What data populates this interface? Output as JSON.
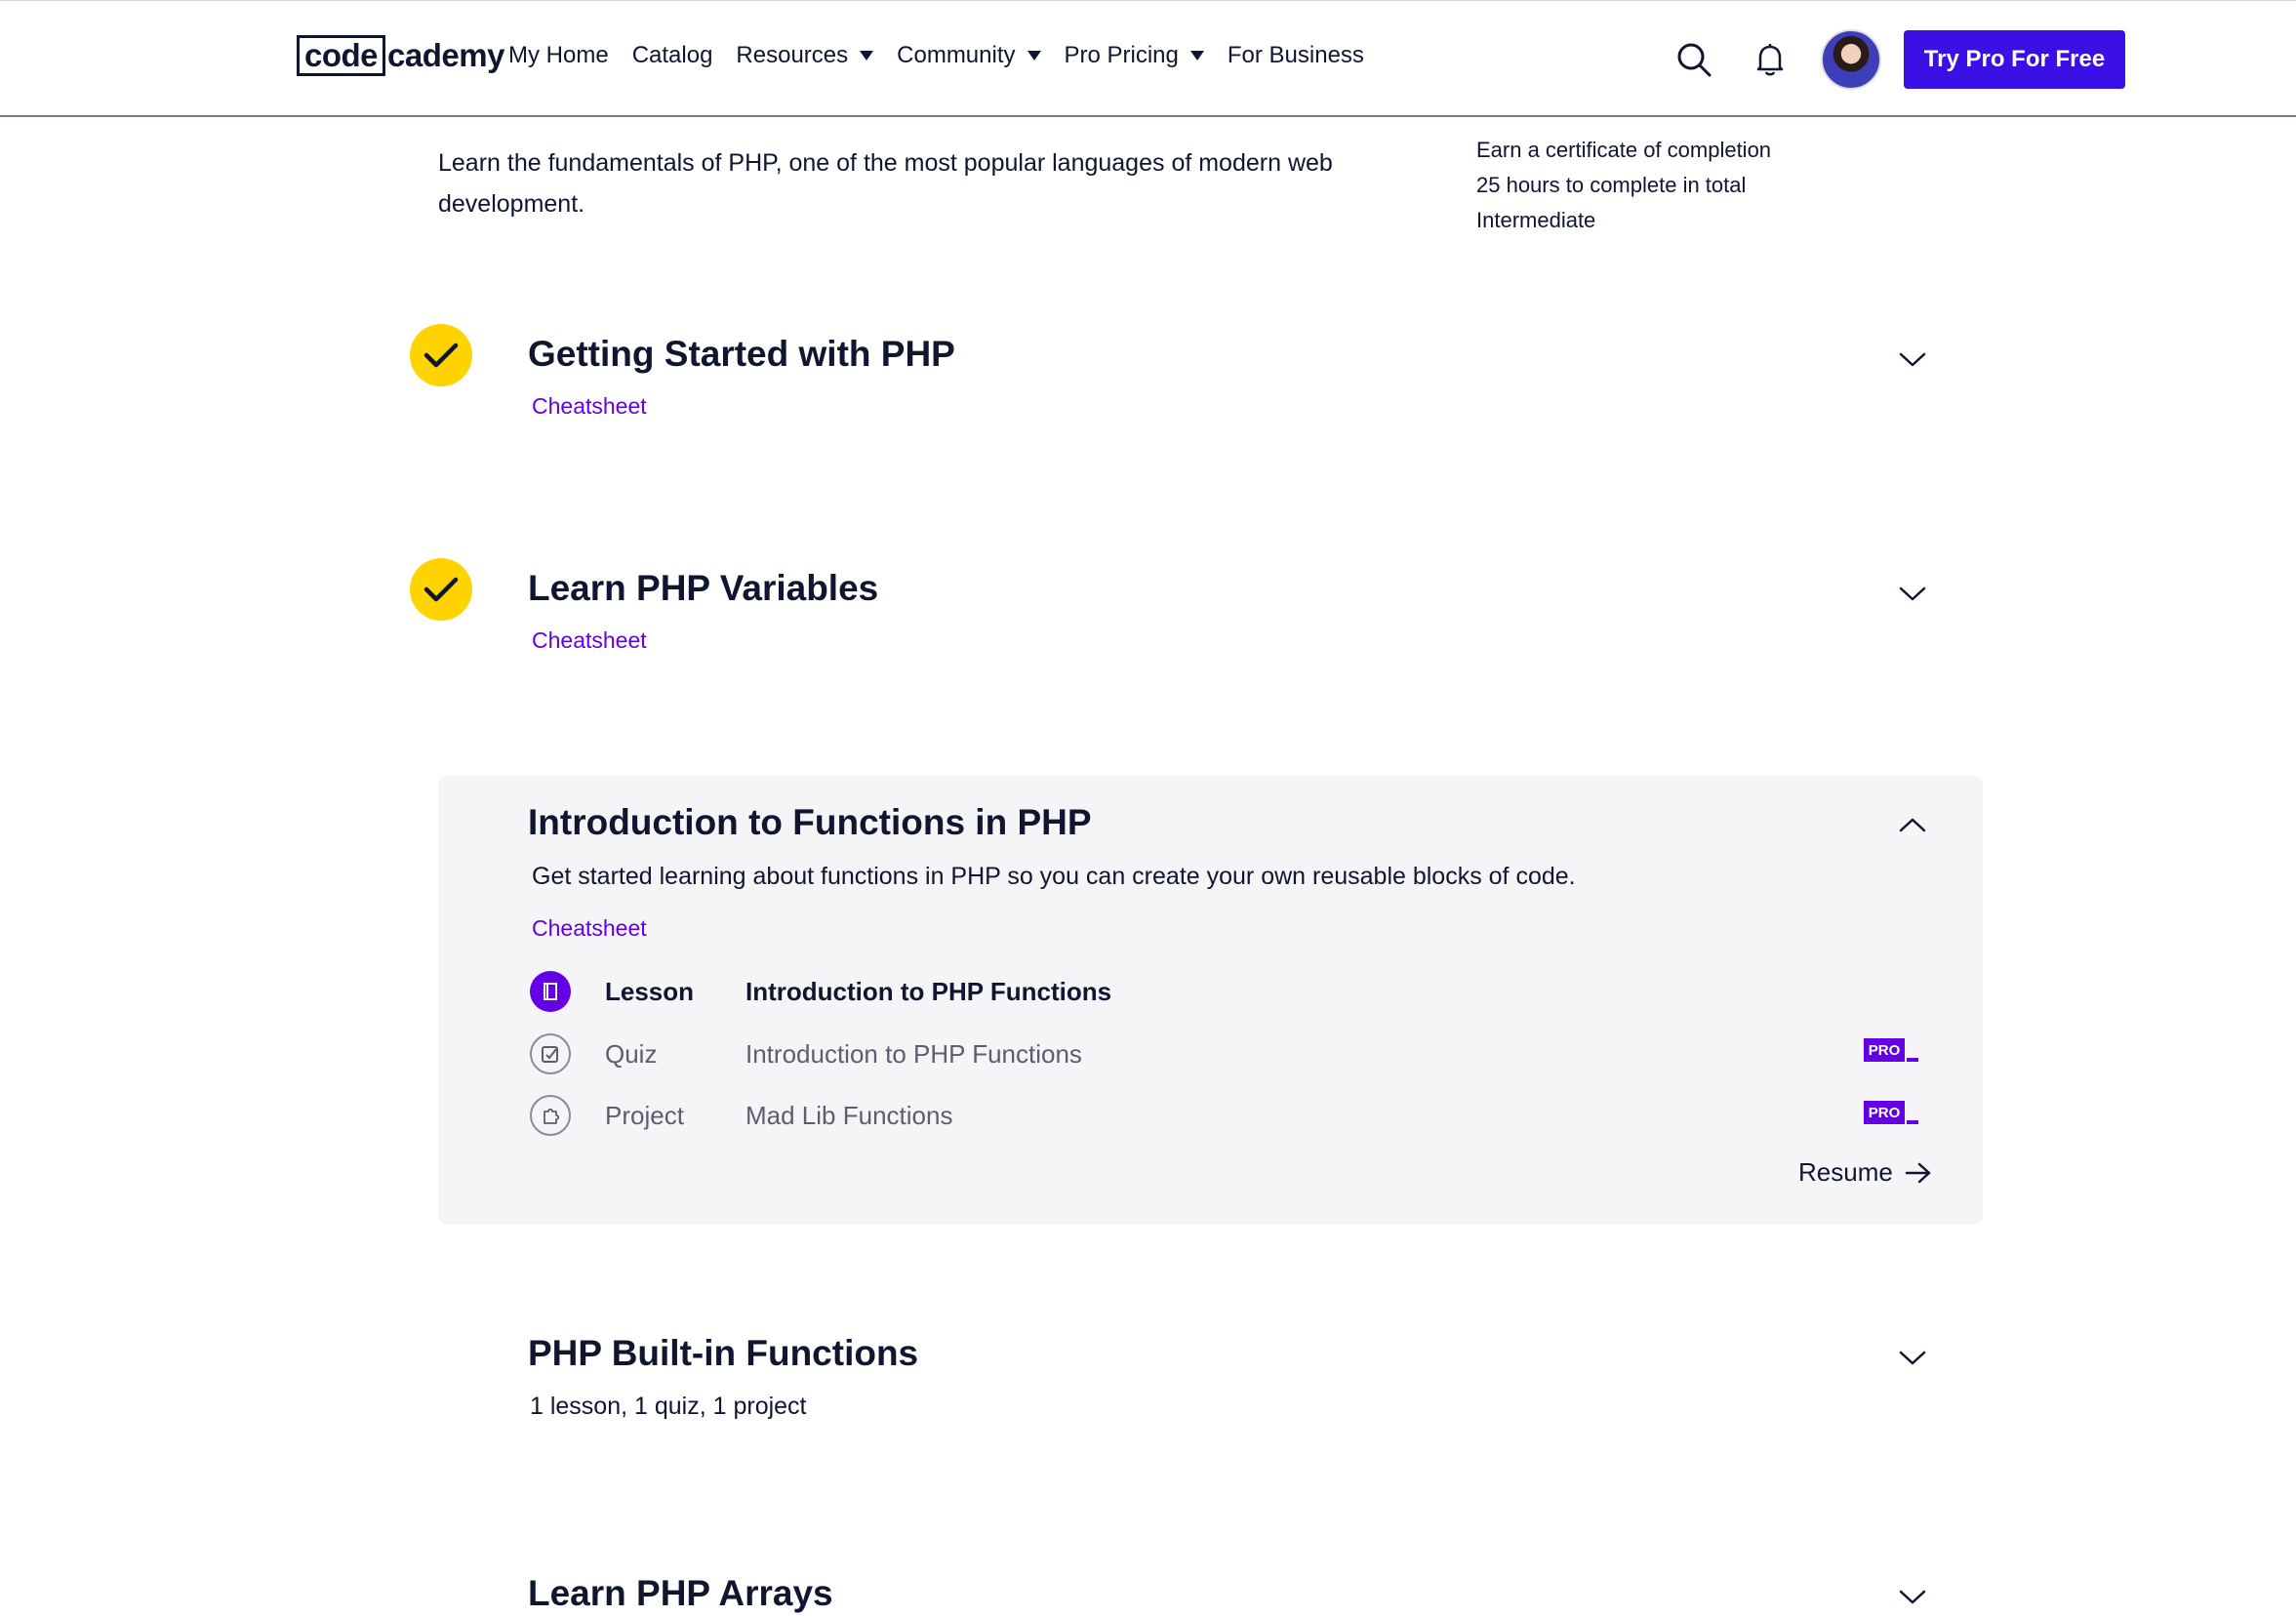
{
  "header": {
    "logo_code": "code",
    "logo_rest": "cademy",
    "nav": [
      {
        "label": "My Home",
        "caret": false
      },
      {
        "label": "Catalog",
        "caret": false
      },
      {
        "label": "Resources",
        "caret": true
      },
      {
        "label": "Community",
        "caret": true
      },
      {
        "label": "Pro Pricing",
        "caret": true
      },
      {
        "label": "For Business",
        "caret": false
      }
    ],
    "cta_label": "Try Pro For Free"
  },
  "intro": {
    "description": "Learn the fundamentals of PHP, one of the most popular languages of modern web development.",
    "facts": [
      "Earn a certificate of completion",
      "25 hours to complete in total",
      "Intermediate"
    ]
  },
  "modules": [
    {
      "title": "Getting Started with PHP",
      "link": "Cheatsheet",
      "completed": true
    },
    {
      "title": "Learn PHP Variables",
      "link": "Cheatsheet",
      "completed": true
    },
    {
      "title": "Introduction to Functions in PHP",
      "description": "Get started learning about functions in PHP so you can create your own reusable blocks of code.",
      "link": "Cheatsheet",
      "expanded": true,
      "items": [
        {
          "type": "Lesson",
          "name": "Introduction to PHP Functions",
          "pro": false,
          "active": true
        },
        {
          "type": "Quiz",
          "name": "Introduction to PHP Functions",
          "pro": true,
          "active": false
        },
        {
          "type": "Project",
          "name": "Mad Lib Functions",
          "pro": true,
          "active": false
        }
      ],
      "resume_label": "Resume"
    },
    {
      "title": "PHP Built-in Functions",
      "summary": "1 lesson, 1 quiz, 1 project"
    },
    {
      "title": "Learn PHP Arrays"
    }
  ],
  "pro_badge": "PRO",
  "colors": {
    "accent": "#3a10e5",
    "link": "#6400e4",
    "check": "#ffd300",
    "panel": "#f5f5f8",
    "text": "#10162f"
  }
}
